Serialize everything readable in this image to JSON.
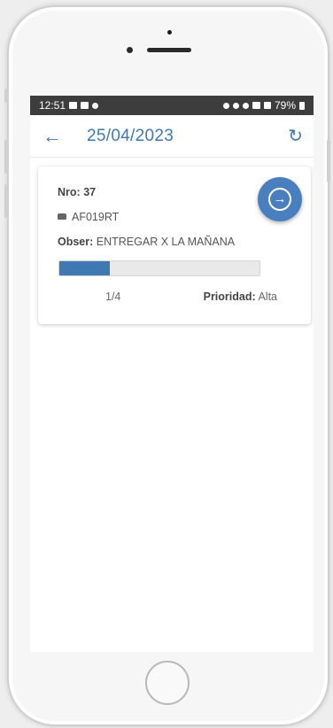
{
  "status_bar": {
    "time": "12:51",
    "battery": "79%"
  },
  "app_bar": {
    "back_icon": "arrow-left-icon",
    "title": "25/04/2023",
    "refresh_icon": "refresh-icon"
  },
  "order_card": {
    "nro_label": "Nro:",
    "nro_value": "37",
    "vehicle_icon": "car-icon",
    "plate": "AF019RT",
    "obs_label": "Obser:",
    "obs_value": "ENTREGAR X LA MAÑANA",
    "progress_fraction": 0.25,
    "progress_text": "1/4",
    "priority_label": "Prioridad:",
    "priority_value": "Alta",
    "go_icon": "arrow-circle-right-icon"
  },
  "colors": {
    "accent": "#3f78b3",
    "status_bar_bg": "#3d3d3d"
  }
}
